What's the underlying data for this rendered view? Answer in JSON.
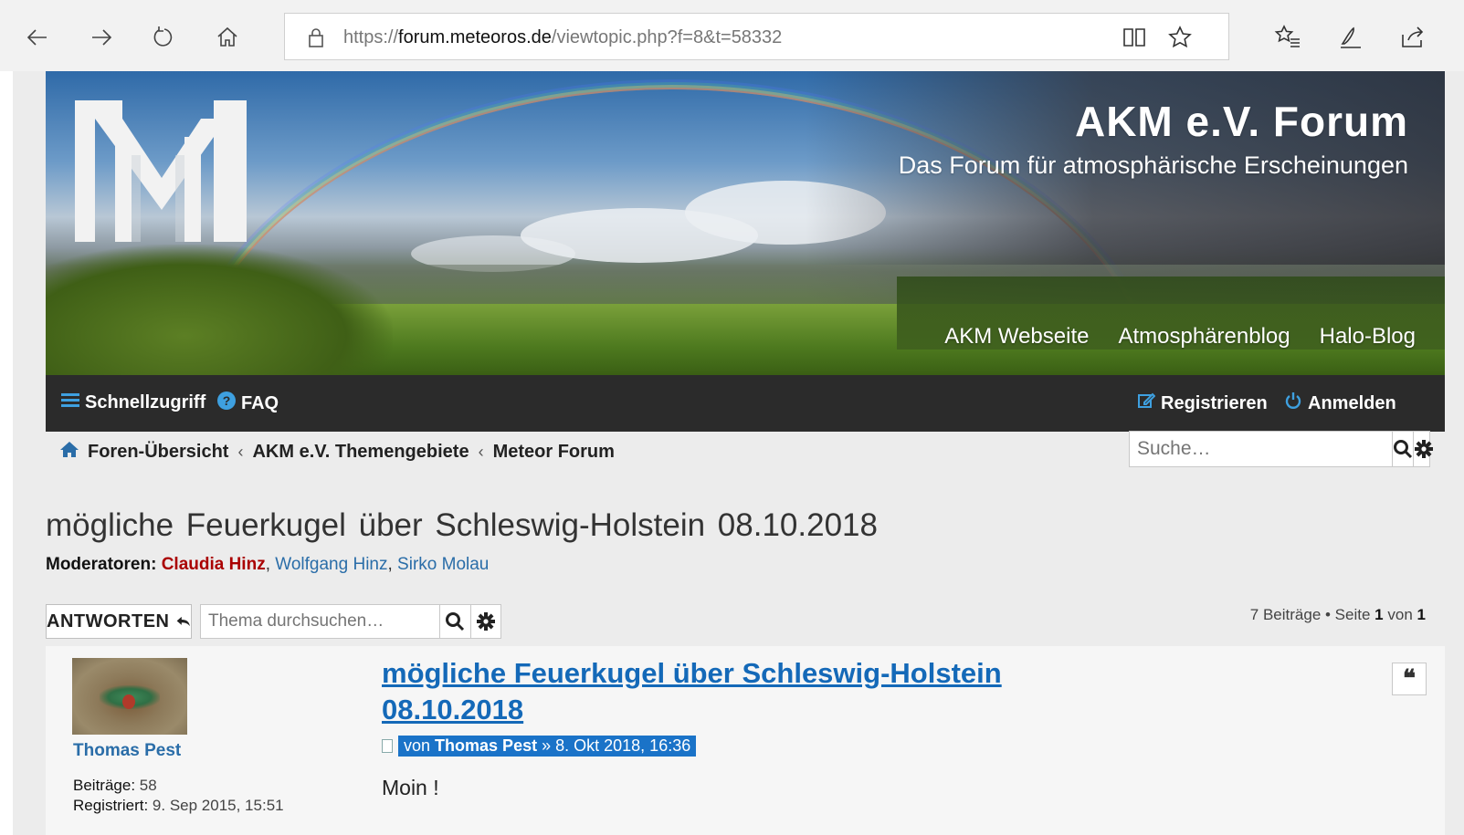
{
  "browser": {
    "url_prefix": "https://",
    "url_host": "forum.meteoros.de",
    "url_path": "/viewtopic.php?f=8&t=58332"
  },
  "header": {
    "site_title": "AKM e.V. Forum",
    "site_description": "Das Forum für atmosphärische Erscheinungen",
    "links": [
      "AKM Webseite",
      "Atmosphärenblog",
      "Halo-Blog"
    ]
  },
  "navbar": {
    "quick_links": "Schnellzugriff",
    "faq": "FAQ",
    "register": "Registrieren",
    "login": "Anmelden"
  },
  "breadcrumb": {
    "items": [
      "Foren-Übersicht",
      "AKM e.V. Themengebiete",
      "Meteor Forum"
    ],
    "separator": "‹"
  },
  "search": {
    "placeholder": "Suche…"
  },
  "topic": {
    "title": "mögliche Feuerkugel über Schleswig-Holstein 08.10.2018",
    "moderators_label": "Moderatoren:",
    "moderators": [
      "Claudia Hinz",
      "Wolfgang Hinz",
      "Sirko Molau"
    ]
  },
  "actions": {
    "reply_label": "ANTWORTEN",
    "topic_search_placeholder": "Thema durchsuchen…",
    "pagination_prefix": "7 Beiträge • Seite",
    "page_current": "1",
    "page_of": "von",
    "page_total": "1"
  },
  "post": {
    "author": "Thomas Pest",
    "posts_label": "Beiträge:",
    "posts_count": "58",
    "registered_label": "Registriert:",
    "registered_date": "9. Sep 2015, 15:51",
    "title": "mögliche Feuerkugel über Schleswig-Holstein 08.10.2018",
    "meta_by": "von",
    "meta_author": "Thomas Pest",
    "meta_date": "» 8. Okt 2018, 16:36",
    "body": "Moin !",
    "quote_glyph": "❝"
  },
  "colors": {
    "link_blue": "#2a6da8",
    "moderator_red": "#aa0000",
    "navbar_bg": "#2b2b2b",
    "highlight": "#1a73c8"
  }
}
